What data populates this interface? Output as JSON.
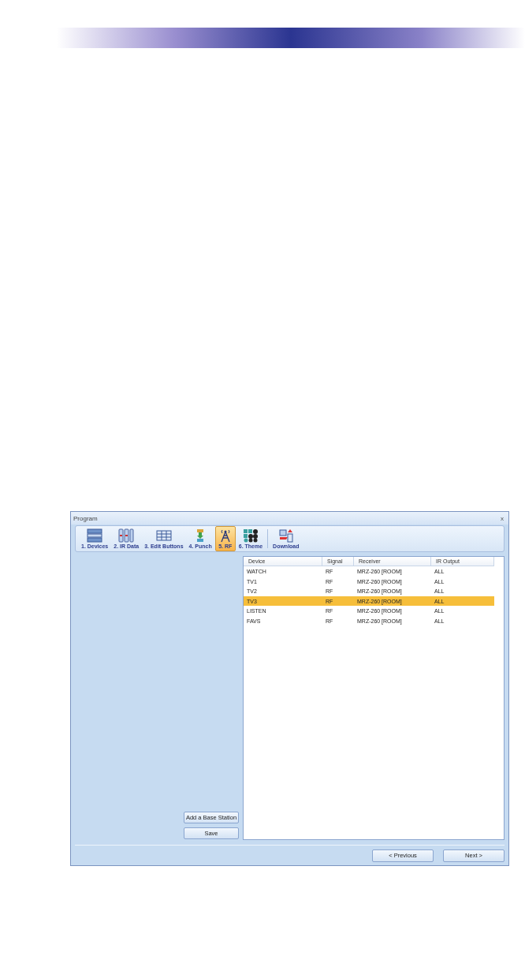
{
  "window": {
    "title": "Program",
    "close": "x"
  },
  "toolbar": [
    {
      "kind": "devices",
      "label": "1. Devices",
      "selected": false
    },
    {
      "kind": "irdata",
      "label": "2. IR Data",
      "selected": false
    },
    {
      "kind": "edit",
      "label": "3. Edit Buttons",
      "selected": false
    },
    {
      "kind": "punch",
      "label": "4. Punch",
      "selected": false
    },
    {
      "kind": "rf",
      "label": "5. RF",
      "selected": true
    },
    {
      "kind": "theme",
      "label": "6. Theme",
      "selected": false
    },
    {
      "kind": "download",
      "label": "Download",
      "selected": false
    }
  ],
  "table": {
    "columns": [
      "Device",
      "Signal",
      "Receiver",
      "IR Output"
    ],
    "rows": [
      {
        "cells": [
          "WATCH",
          "RF",
          "MRZ-260 [ROOM]",
          "ALL"
        ],
        "selected": false
      },
      {
        "cells": [
          "TV1",
          "RF",
          "MRZ-260 [ROOM]",
          "ALL"
        ],
        "selected": false
      },
      {
        "cells": [
          "TV2",
          "RF",
          "MRZ-260 [ROOM]",
          "ALL"
        ],
        "selected": false
      },
      {
        "cells": [
          "TV3",
          "RF",
          "MRZ-260 [ROOM]",
          "ALL"
        ],
        "selected": true
      },
      {
        "cells": [
          "LISTEN",
          "RF",
          "MRZ-260 [ROOM]",
          "ALL"
        ],
        "selected": false
      },
      {
        "cells": [
          "FAVS",
          "RF",
          "MRZ-260 [ROOM]",
          "ALL"
        ],
        "selected": false
      }
    ]
  },
  "side_buttons": [
    "Add a Base Station",
    "Save"
  ],
  "footer_buttons": [
    "< Previous",
    "Next >"
  ]
}
